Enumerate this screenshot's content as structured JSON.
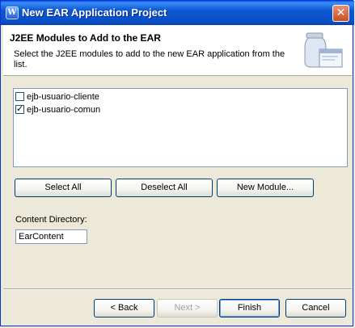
{
  "window": {
    "title": "New EAR Application Project",
    "close_label": "✕"
  },
  "banner": {
    "title": "J2EE Modules to Add to the EAR",
    "description": "Select the J2EE modules to add to the new EAR application from the list.",
    "icon": "jar-window-icon"
  },
  "modules": [
    {
      "label": "ejb-usuario-cliente",
      "checked": false
    },
    {
      "label": "ejb-usuario-comun",
      "checked": true
    }
  ],
  "actions": {
    "select_all": "Select All",
    "deselect_all": "Deselect All",
    "new_module": "New Module..."
  },
  "content_directory": {
    "label": "Content Directory:",
    "value": "EarContent"
  },
  "footer": {
    "back": "< Back",
    "next": "Next >",
    "finish": "Finish",
    "cancel": "Cancel"
  }
}
